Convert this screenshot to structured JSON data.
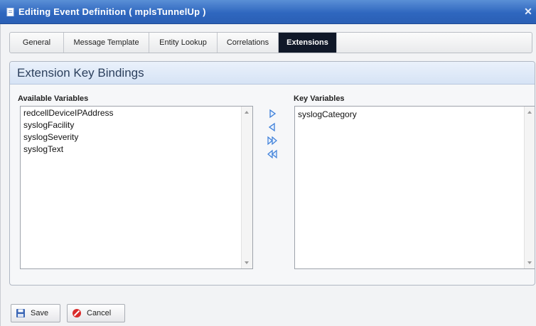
{
  "window": {
    "title": "Editing Event Definition ( mplsTunnelUp )",
    "close_icon": "close-icon",
    "accent_color": "#2f67bf"
  },
  "tabs": [
    {
      "label": "General",
      "active": false
    },
    {
      "label": "Message Template",
      "active": false
    },
    {
      "label": "Entity Lookup",
      "active": false
    },
    {
      "label": "Correlations",
      "active": false
    },
    {
      "label": "Extensions",
      "active": true
    }
  ],
  "panel": {
    "title": "Extension Key Bindings"
  },
  "available": {
    "label": "Available Variables",
    "items": [
      "redcellDeviceIPAddress",
      "syslogFacility",
      "syslogSeverity",
      "syslogText"
    ]
  },
  "key": {
    "label": "Key Variables",
    "items": [
      "syslogCategory"
    ]
  },
  "move_buttons": [
    {
      "name": "move-right-icon",
      "icon": "single-arrow-right"
    },
    {
      "name": "move-left-icon",
      "icon": "single-arrow-left"
    },
    {
      "name": "move-all-right-icon",
      "icon": "double-arrow-right"
    },
    {
      "name": "move-all-left-icon",
      "icon": "double-arrow-left"
    }
  ],
  "footer": {
    "save_label": "Save",
    "save_icon": "floppy-disk-icon",
    "cancel_label": "Cancel",
    "cancel_icon": "cancel-circle-icon"
  }
}
